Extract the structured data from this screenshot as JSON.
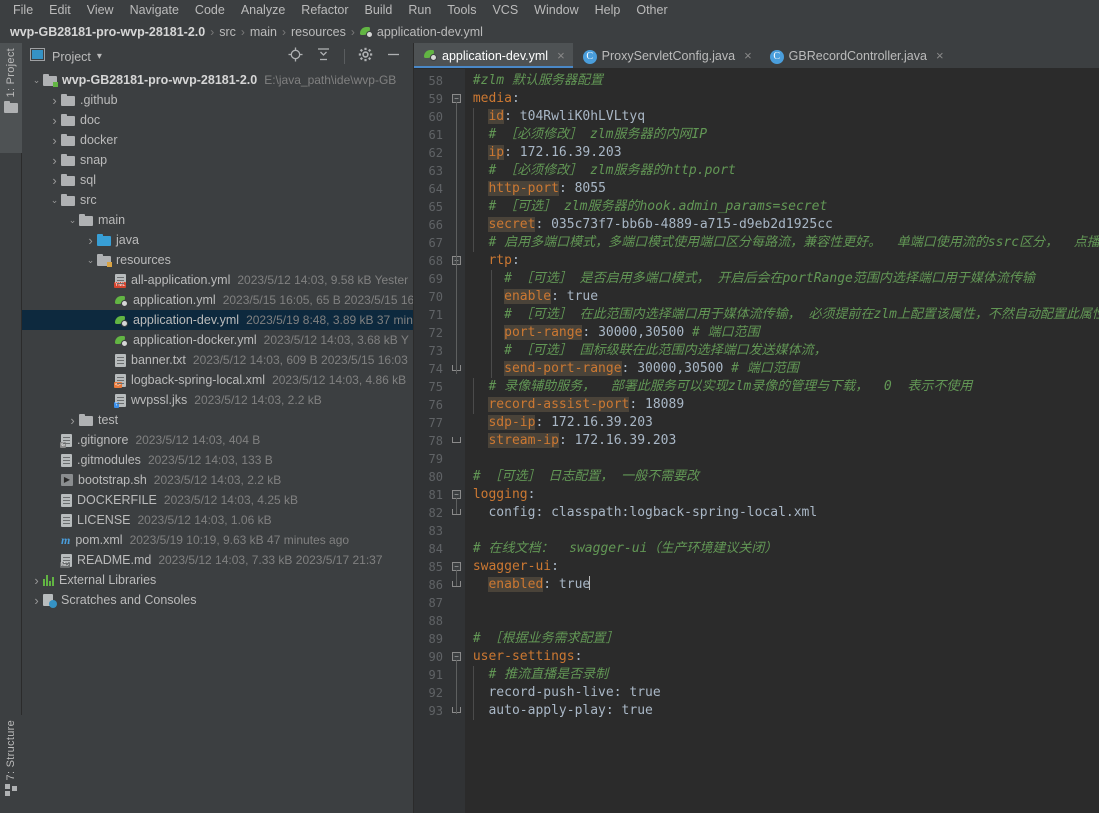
{
  "menubar": {
    "items": [
      "File",
      "Edit",
      "View",
      "Navigate",
      "Code",
      "Analyze",
      "Refactor",
      "Build",
      "Run",
      "Tools",
      "VCS",
      "Window",
      "Help",
      "Other"
    ]
  },
  "breadcrumb": {
    "root": "wvp-GB28181-pro-wvp-28181-2.0",
    "parts": [
      "src",
      "main",
      "resources"
    ],
    "file": "application-dev.yml",
    "separator": "›"
  },
  "left_strip": {
    "project": "1: Project",
    "structure": "7: Structure"
  },
  "project_panel": {
    "title": "Project",
    "caret": "▾",
    "actions": [
      "locate-icon",
      "collapse-all-icon",
      "settings-icon",
      "hide-icon"
    ],
    "tree": [
      {
        "depth": 0,
        "arrow": "⌄",
        "icon": "folder-module",
        "label": "wvp-GB28181-pro-wvp-28181-2.0",
        "bold": true,
        "meta": "E:\\java_path\\ide\\wvp-GB",
        "selected": false
      },
      {
        "depth": 1,
        "arrow": "›",
        "icon": "folder",
        "label": ".github",
        "meta": "",
        "selected": false
      },
      {
        "depth": 1,
        "arrow": "›",
        "icon": "folder",
        "label": "doc",
        "meta": "",
        "selected": false
      },
      {
        "depth": 1,
        "arrow": "›",
        "icon": "folder",
        "label": "docker",
        "meta": "",
        "selected": false
      },
      {
        "depth": 1,
        "arrow": "›",
        "icon": "folder",
        "label": "snap",
        "meta": "",
        "selected": false
      },
      {
        "depth": 1,
        "arrow": "›",
        "icon": "folder",
        "label": "sql",
        "meta": "",
        "selected": false
      },
      {
        "depth": 1,
        "arrow": "⌄",
        "icon": "folder",
        "label": "src",
        "meta": "",
        "selected": false
      },
      {
        "depth": 2,
        "arrow": "⌄",
        "icon": "folder",
        "label": "main",
        "meta": "",
        "selected": false
      },
      {
        "depth": 3,
        "arrow": "›",
        "icon": "folder-source",
        "label": "java",
        "meta": "",
        "selected": false
      },
      {
        "depth": 3,
        "arrow": "⌄",
        "icon": "folder-resources",
        "label": "resources",
        "meta": "",
        "selected": false
      },
      {
        "depth": 4,
        "arrow": "",
        "icon": "yml-file-plain",
        "label": "all-application.yml",
        "meta": "2023/5/12 14:03, 9.58 kB  Yester",
        "selected": false
      },
      {
        "depth": 4,
        "arrow": "",
        "icon": "yml-spring",
        "label": "application.yml",
        "meta": "2023/5/15 16:05, 65 B  2023/5/15 16",
        "selected": false
      },
      {
        "depth": 4,
        "arrow": "",
        "icon": "yml-spring",
        "label": "application-dev.yml",
        "meta": "2023/5/19 8:48, 3.89 kB  37 min",
        "selected": true
      },
      {
        "depth": 4,
        "arrow": "",
        "icon": "yml-spring",
        "label": "application-docker.yml",
        "meta": "2023/5/12 14:03, 3.68 kB  Y",
        "selected": false
      },
      {
        "depth": 4,
        "arrow": "",
        "icon": "txt-file",
        "label": "banner.txt",
        "meta": "2023/5/12 14:03, 609 B  2023/5/15 16:03",
        "selected": false
      },
      {
        "depth": 4,
        "arrow": "",
        "icon": "xml-file",
        "label": "logback-spring-local.xml",
        "meta": "2023/5/12 14:03, 4.86 kB",
        "selected": false
      },
      {
        "depth": 4,
        "arrow": "",
        "icon": "jks-file",
        "label": "wvpssl.jks",
        "meta": "2023/5/12 14:03, 2.2 kB",
        "selected": false
      },
      {
        "depth": 2,
        "arrow": "›",
        "icon": "folder",
        "label": "test",
        "meta": "",
        "selected": false
      },
      {
        "depth": 1,
        "arrow": "",
        "icon": "gitignore-file",
        "label": ".gitignore",
        "meta": "2023/5/12 14:03, 404 B",
        "selected": false
      },
      {
        "depth": 1,
        "arrow": "",
        "icon": "text-file",
        "label": ".gitmodules",
        "meta": "2023/5/12 14:03, 133 B",
        "selected": false
      },
      {
        "depth": 1,
        "arrow": "",
        "icon": "shell-file",
        "label": "bootstrap.sh",
        "meta": "2023/5/12 14:03, 2.2 kB",
        "selected": false
      },
      {
        "depth": 1,
        "arrow": "",
        "icon": "text-file",
        "label": "DOCKERFILE",
        "meta": "2023/5/12 14:03, 4.25 kB",
        "selected": false
      },
      {
        "depth": 1,
        "arrow": "",
        "icon": "text-file",
        "label": "LICENSE",
        "meta": "2023/5/12 14:03, 1.06 kB",
        "selected": false
      },
      {
        "depth": 1,
        "arrow": "",
        "icon": "maven-file",
        "label": "pom.xml",
        "meta": "2023/5/19 10:19, 9.63 kB  47 minutes ago",
        "selected": false
      },
      {
        "depth": 1,
        "arrow": "",
        "icon": "md-file",
        "label": "README.md",
        "meta": "2023/5/12 14:03, 7.33 kB  2023/5/17 21:37",
        "selected": false
      },
      {
        "depth": 0,
        "arrow": "›",
        "icon": "library-icon",
        "label": "External Libraries",
        "meta": "",
        "selected": false
      },
      {
        "depth": 0,
        "arrow": "›",
        "icon": "scratch-icon",
        "label": "Scratches and Consoles",
        "meta": "",
        "selected": false
      }
    ]
  },
  "editor": {
    "tabs": [
      {
        "label": "application-dev.yml",
        "icon": "yml-spring",
        "active": true,
        "close": "×"
      },
      {
        "label": "ProxyServletConfig.java",
        "icon": "class-icon",
        "active": false,
        "close": "×"
      },
      {
        "label": "GBRecordController.java",
        "icon": "class-icon",
        "active": false,
        "close": "×"
      }
    ],
    "first_line_number": 58,
    "lines": [
      {
        "n": 58,
        "indent": 0,
        "tokens": [
          {
            "t": "comment",
            "v": "#zlm 默认服务器配置"
          }
        ]
      },
      {
        "n": 59,
        "indent": 0,
        "fold": "open",
        "tokens": [
          {
            "t": "key",
            "v": "media"
          },
          {
            "t": "plain",
            "v": ":"
          }
        ]
      },
      {
        "n": 60,
        "indent": 1,
        "tokens": [
          {
            "t": "keyhl",
            "v": "id"
          },
          {
            "t": "plain",
            "v": ": t04RwliK0hLVLtyq"
          }
        ]
      },
      {
        "n": 61,
        "indent": 1,
        "tokens": [
          {
            "t": "comment",
            "v": "# ［必须修改］ zlm服务器的内网IP"
          }
        ]
      },
      {
        "n": 62,
        "indent": 1,
        "tokens": [
          {
            "t": "keyhl",
            "v": "ip"
          },
          {
            "t": "plain",
            "v": ": 172.16.39.203"
          }
        ]
      },
      {
        "n": 63,
        "indent": 1,
        "tokens": [
          {
            "t": "comment",
            "v": "# ［必须修改］ zlm服务器的http.port"
          }
        ]
      },
      {
        "n": 64,
        "indent": 1,
        "tokens": [
          {
            "t": "keyhl",
            "v": "http-port"
          },
          {
            "t": "plain",
            "v": ": 8055"
          }
        ]
      },
      {
        "n": 65,
        "indent": 1,
        "tokens": [
          {
            "t": "comment",
            "v": "# ［可选］ zlm服务器的hook.admin_params=secret"
          }
        ]
      },
      {
        "n": 66,
        "indent": 1,
        "tokens": [
          {
            "t": "keyhl",
            "v": "secret"
          },
          {
            "t": "plain",
            "v": ": 035c73f7-bb6b-4889-a715-d9eb2d1925cc"
          }
        ]
      },
      {
        "n": 67,
        "indent": 1,
        "tokens": [
          {
            "t": "comment",
            "v": "# 启用多端口模式，多端口模式使用端口区分每路流，兼容性更好。  单端口使用流的ssrc区分，  点播起"
          }
        ]
      },
      {
        "n": 68,
        "indent": 1,
        "fold": "open",
        "tokens": [
          {
            "t": "key",
            "v": "rtp"
          },
          {
            "t": "plain",
            "v": ":"
          }
        ]
      },
      {
        "n": 69,
        "indent": 2,
        "tokens": [
          {
            "t": "comment",
            "v": "# ［可选］ 是否启用多端口模式， 开启后会在portRange范围内选择端口用于媒体流传输"
          }
        ]
      },
      {
        "n": 70,
        "indent": 2,
        "tokens": [
          {
            "t": "keyhl",
            "v": "enable"
          },
          {
            "t": "plain",
            "v": ": true"
          }
        ]
      },
      {
        "n": 71,
        "indent": 2,
        "tokens": [
          {
            "t": "comment",
            "v": "# ［可选］ 在此范围内选择端口用于媒体流传输， 必须提前在zlm上配置该属性，不然自动配置此属性"
          }
        ]
      },
      {
        "n": 72,
        "indent": 2,
        "tokens": [
          {
            "t": "keyhl",
            "v": "port-range"
          },
          {
            "t": "plain",
            "v": ": 30000,30500 "
          },
          {
            "t": "comment",
            "v": "# 端口范围"
          }
        ]
      },
      {
        "n": 73,
        "indent": 2,
        "tokens": [
          {
            "t": "comment",
            "v": "# ［可选］ 国标级联在此范围内选择端口发送媒体流，"
          }
        ]
      },
      {
        "n": 74,
        "indent": 2,
        "fold": "end",
        "tokens": [
          {
            "t": "keyhl",
            "v": "send-port-range"
          },
          {
            "t": "plain",
            "v": ": 30000,30500 "
          },
          {
            "t": "comment",
            "v": "# 端口范围"
          }
        ]
      },
      {
        "n": 75,
        "indent": 1,
        "tokens": [
          {
            "t": "comment",
            "v": "# 录像辅助服务，  部署此服务可以实现zlm录像的管理与下载，  0  表示不使用"
          }
        ]
      },
      {
        "n": 76,
        "indent": 1,
        "tokens": [
          {
            "t": "keyhl",
            "v": "record-assist-port"
          },
          {
            "t": "plain",
            "v": ": 18089"
          }
        ]
      },
      {
        "n": 77,
        "indent": 1,
        "tokens": [
          {
            "t": "keyhl",
            "v": "sdp-ip"
          },
          {
            "t": "plain",
            "v": ": 172.16.39.203"
          }
        ]
      },
      {
        "n": 78,
        "indent": 1,
        "fold": "end",
        "tokens": [
          {
            "t": "keyhl",
            "v": "stream-ip"
          },
          {
            "t": "plain",
            "v": ": 172.16.39.203"
          }
        ]
      },
      {
        "n": 79,
        "indent": 0,
        "tokens": []
      },
      {
        "n": 80,
        "indent": 0,
        "tokens": [
          {
            "t": "comment",
            "v": "# ［可选］ 日志配置， 一般不需要改"
          }
        ]
      },
      {
        "n": 81,
        "indent": 0,
        "fold": "open",
        "tokens": [
          {
            "t": "key",
            "v": "logging"
          },
          {
            "t": "plain",
            "v": ":"
          }
        ]
      },
      {
        "n": 82,
        "indent": 1,
        "fold": "end",
        "tokens": [
          {
            "t": "plain",
            "v": "config: classpath:logback-spring-local.xml"
          }
        ]
      },
      {
        "n": 83,
        "indent": 0,
        "tokens": []
      },
      {
        "n": 84,
        "indent": 0,
        "tokens": [
          {
            "t": "comment",
            "v": "# 在线文档：  swagger-ui（生产环境建议关闭）"
          }
        ]
      },
      {
        "n": 85,
        "indent": 0,
        "fold": "open",
        "tokens": [
          {
            "t": "key",
            "v": "swagger-ui"
          },
          {
            "t": "plain",
            "v": ":"
          }
        ]
      },
      {
        "n": 86,
        "indent": 1,
        "fold": "end",
        "caret": true,
        "tokens": [
          {
            "t": "keyhl",
            "v": "enabled"
          },
          {
            "t": "plain",
            "v": ": true"
          }
        ]
      },
      {
        "n": 87,
        "indent": 0,
        "tokens": []
      },
      {
        "n": 88,
        "indent": 0,
        "tokens": []
      },
      {
        "n": 89,
        "indent": 0,
        "tokens": [
          {
            "t": "comment",
            "v": "# ［根据业务需求配置］"
          }
        ]
      },
      {
        "n": 90,
        "indent": 0,
        "fold": "open",
        "tokens": [
          {
            "t": "key",
            "v": "user-settings"
          },
          {
            "t": "plain",
            "v": ":"
          }
        ]
      },
      {
        "n": 91,
        "indent": 1,
        "tokens": [
          {
            "t": "comment",
            "v": "# 推流直播是否录制"
          }
        ]
      },
      {
        "n": 92,
        "indent": 1,
        "tokens": [
          {
            "t": "plain",
            "v": "record-push-live: true"
          }
        ]
      },
      {
        "n": 93,
        "indent": 1,
        "fold": "end",
        "tokens": [
          {
            "t": "plain",
            "v": "auto-apply-play: true"
          }
        ]
      }
    ]
  },
  "colors": {
    "background": "#3c3f41",
    "editor_background": "#2b2b2b",
    "gutter_background": "#313335",
    "selection": "#0d293e",
    "tab_active": "#4e5254",
    "tab_underline": "#4a88c7",
    "keyword": "#cc7832",
    "comment": "#629755",
    "text": "#a9b7c6",
    "key_highlight": "#7a6a4f"
  }
}
